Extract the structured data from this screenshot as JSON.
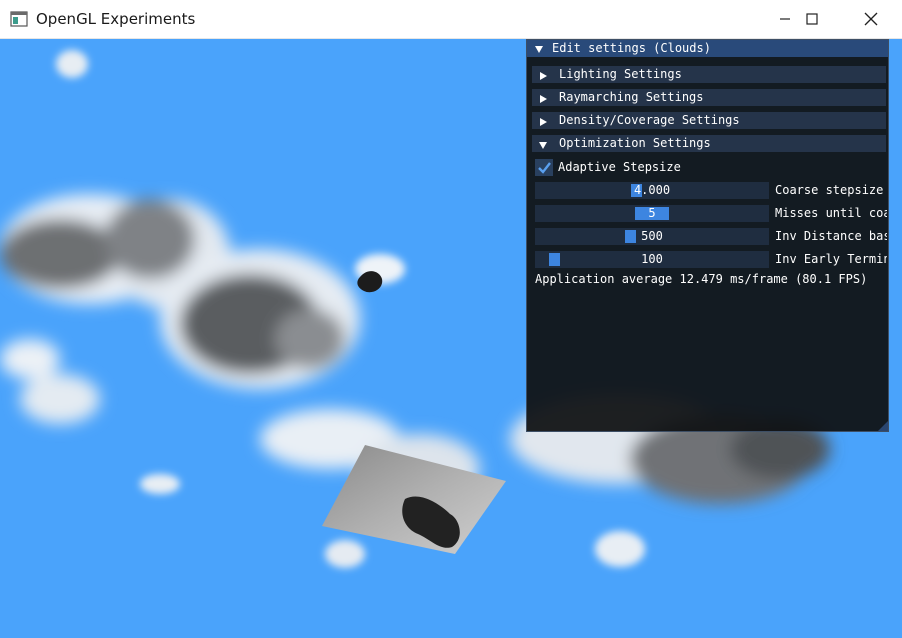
{
  "window": {
    "title": "OpenGL Experiments"
  },
  "panel": {
    "title": "Edit settings (Clouds)",
    "headers": [
      {
        "label": "Lighting Settings",
        "open": false
      },
      {
        "label": "Raymarching Settings",
        "open": false
      },
      {
        "label": "Density/Coverage Settings",
        "open": false
      },
      {
        "label": "Optimization Settings",
        "open": true
      }
    ],
    "checkbox": {
      "label": "Adaptive Stepsize",
      "checked": true
    },
    "sliders": [
      {
        "value": "4.000",
        "label": "Coarse stepsize",
        "fraction": 0.43
      },
      {
        "value": "5",
        "label": "Misses until coa",
        "fraction": 0.43
      },
      {
        "value": "500",
        "label": "Inv Distance bas",
        "fraction": 0.39
      },
      {
        "value": "100",
        "label": "Inv Early Termin",
        "fraction": 0.06
      }
    ],
    "stats": "Application average 12.479 ms/frame (80.1 FPS)"
  },
  "colors": {
    "sky": "#4aa3fb",
    "panel_bg": "#101214",
    "title_bar": "#294a7a",
    "header": "#25344a",
    "accent": "#3d85e0"
  }
}
